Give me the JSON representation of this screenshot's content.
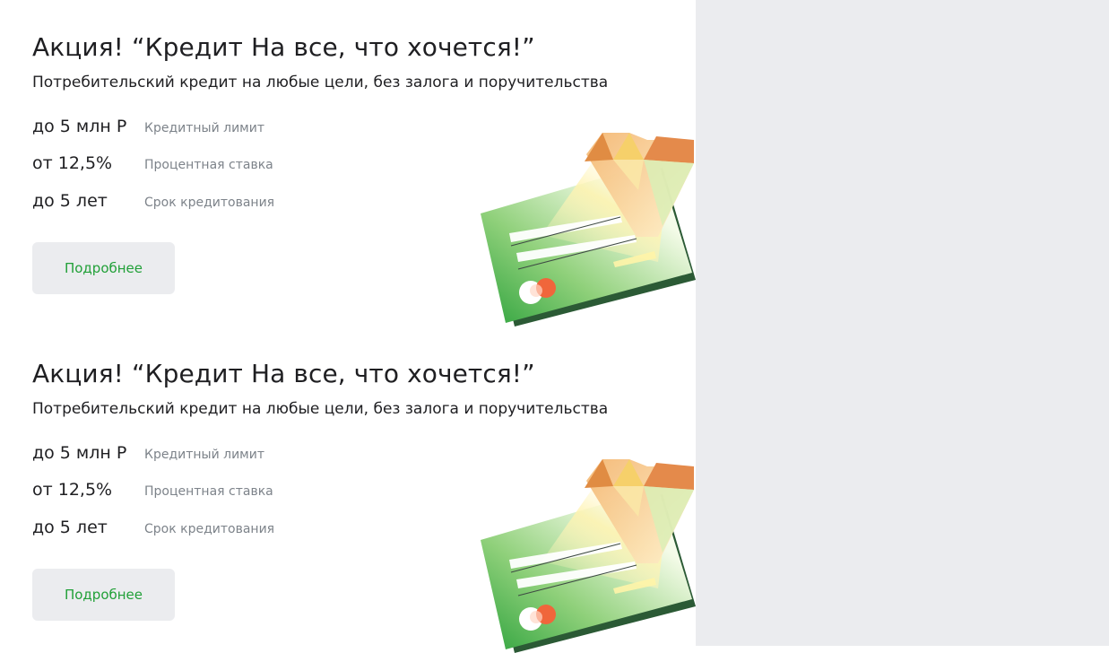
{
  "offers": [
    {
      "title": "Акция! “Кредит На все, что хочется!”",
      "subtitle": "Потребительский кредит на любые цели, без залога и поручительства",
      "params": [
        {
          "value": "до 5 млн Р",
          "label": "Кредитный лимит"
        },
        {
          "value": "от 12,5%",
          "label": "Процентная ставка"
        },
        {
          "value": "до 5 лет",
          "label": "Срок кредитования"
        }
      ],
      "button_label": "Подробнее"
    },
    {
      "title": "Акция! “Кредит На все, что хочется!”",
      "subtitle": "Потребительский кредит на любые цели, без залога и поручительства",
      "params": [
        {
          "value": "до 5 млн Р",
          "label": "Кредитный лимит"
        },
        {
          "value": "от 12,5%",
          "label": "Процентная ставка"
        },
        {
          "value": "до 5 лет",
          "label": "Срок кредитования"
        }
      ],
      "button_label": "Подробнее"
    }
  ],
  "illustration_icon": "credit-card-with-diamond-icon",
  "colors": {
    "accent_green": "#21a038",
    "text_primary": "#1f1f22",
    "text_secondary": "#7d838a",
    "button_bg": "#ebecef",
    "side_panel_bg": "#ebecef"
  }
}
